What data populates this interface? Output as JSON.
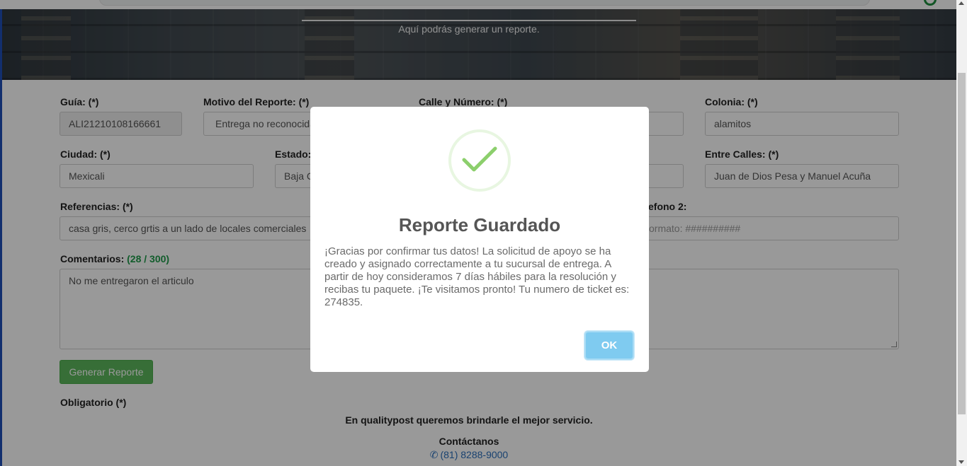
{
  "hero": {
    "subtitle": "Aquí podrás generar un reporte."
  },
  "form": {
    "guia": {
      "label": "Guía:",
      "req": "(*)",
      "value": "ALI21210108166661"
    },
    "motivo": {
      "label": "Motivo del Reporte:",
      "req": "(*)",
      "value": "Entrega no reconocida"
    },
    "calle": {
      "label": "Calle y Número:",
      "req": "(*)",
      "value": ""
    },
    "colonia": {
      "label": "Colonia:",
      "req": "(*)",
      "value": "alamitos"
    },
    "ciudad": {
      "label": "Ciudad:",
      "req": "(*)",
      "value": "Mexicali"
    },
    "estado": {
      "label": "Estado:",
      "value": "Baja California"
    },
    "entre_calles": {
      "label": "Entre Calles:",
      "req": "(*)",
      "value": "Juan de Dios Pesa y Manuel Acuña"
    },
    "referencias": {
      "label": "Referencias:",
      "req": "(*)",
      "value": "casa gris, cerco grtis a un lado de locales comerciales"
    },
    "telefono2": {
      "label_fragment": "efono 2:",
      "placeholder_fragment": "ormato: ##########"
    },
    "comentarios": {
      "label": "Comentarios:",
      "counter": "(28 / 300)",
      "value": "No me entregaron el articulo"
    },
    "generate_button": "Generar Reporte",
    "obligatorio": "Obligatorio (*)"
  },
  "footer": {
    "tagline": "En qualitypost queremos brindarle el mejor servicio.",
    "contact_heading": "Contáctanos",
    "phone": "(81) 8288-9000"
  },
  "modal": {
    "title": "Reporte Guardado",
    "message": "¡Gracias por confirmar tus datos! La solicitud de apoyo se ha creado y asignado correctamente a tu sucursal de entrega. A partir de hoy consideramos 7 días hábiles para la resolución y recibas tu paquete. ¡Te visitamos pronto! Tu numero de ticket es: 274835.",
    "ok_label": "OK"
  },
  "colors": {
    "success_green": "#8ccf6c",
    "ok_button": "#7fcbf0",
    "generate_button": "#5cb85c",
    "counter_green": "#1e9c4a"
  }
}
